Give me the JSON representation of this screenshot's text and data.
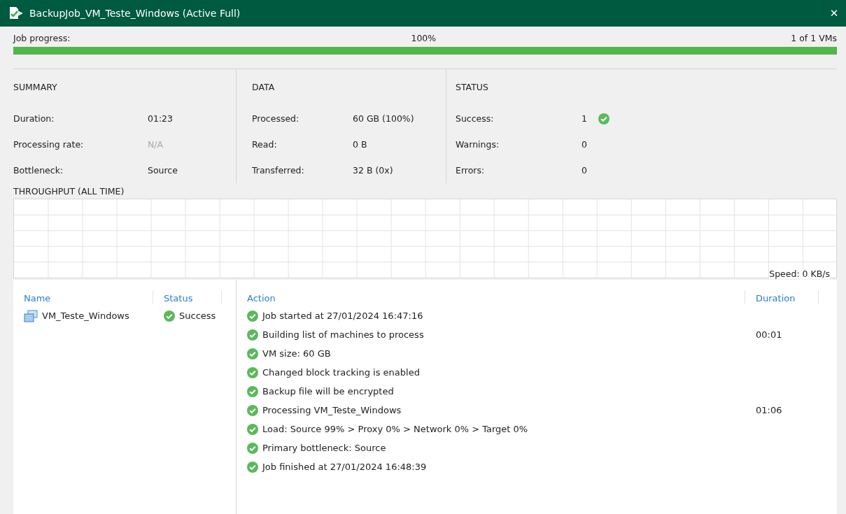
{
  "window": {
    "title": "BackupJob_VM_Teste_Windows (Active Full)",
    "close": "✕"
  },
  "progress": {
    "label": "Job progress:",
    "percent": "100%",
    "level": 1,
    "count": "1 of 1 VMs"
  },
  "summary": {
    "heading": "SUMMARY",
    "items": [
      {
        "label": "Duration:",
        "value": "01:23",
        "disabled": false
      },
      {
        "label": "Processing rate:",
        "value": "N/A",
        "disabled": true
      },
      {
        "label": "Bottleneck:",
        "value": "Source",
        "disabled": false
      }
    ]
  },
  "data": {
    "heading": "DATA",
    "items": [
      {
        "label": "Processed:",
        "value": "60 GB (100%)"
      },
      {
        "label": "Read:",
        "value": "0 B"
      },
      {
        "label": "Transferred:",
        "value": "32 B (0x)"
      }
    ]
  },
  "status": {
    "heading": "STATUS",
    "items": [
      {
        "label": "Success:",
        "value": "1",
        "kind": "success"
      },
      {
        "label": "Warnings:",
        "value": "0",
        "kind": "plain"
      },
      {
        "label": "Errors:",
        "value": "0",
        "kind": "plain"
      }
    ]
  },
  "throughput": {
    "title": "THROUGHPUT (ALL TIME)",
    "speed": "Speed: 0 KB/s"
  },
  "vms": {
    "columns": [
      "Name",
      "Status"
    ],
    "rows": [
      {
        "name": "VM_Teste_Windows",
        "status": "Success",
        "kind": "success"
      }
    ]
  },
  "log": {
    "columns": [
      "Action",
      "Duration"
    ],
    "rows": [
      {
        "action": "Job started at 27/01/2024 16:47:16",
        "kind": "success"
      },
      {
        "action": "Building list of machines to process",
        "duration": "00:01",
        "kind": "success"
      },
      {
        "action": "VM size: 60 GB",
        "kind": "success"
      },
      {
        "action": "Changed block tracking is enabled",
        "kind": "success"
      },
      {
        "action": "Backup file will be encrypted",
        "kind": "success"
      },
      {
        "action": "Processing VM_Teste_Windows",
        "duration": "01:06",
        "kind": "success"
      },
      {
        "action": "Load: Source 99% > Proxy 0% > Network 0% > Target 0%",
        "kind": "success"
      },
      {
        "action": "Primary bottleneck: Source",
        "kind": "success"
      },
      {
        "action": "Job finished at 27/01/2024 16:48:39",
        "kind": "success"
      }
    ]
  }
}
